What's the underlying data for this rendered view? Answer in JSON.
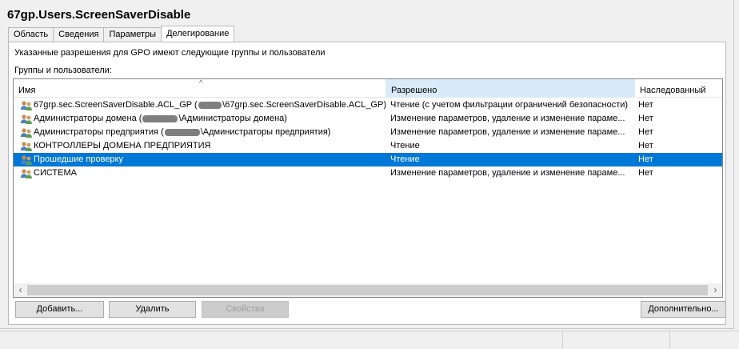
{
  "window": {
    "title": "67gp.Users.ScreenSaverDisable"
  },
  "tabs": [
    {
      "label": "Область",
      "active": false
    },
    {
      "label": "Сведения",
      "active": false
    },
    {
      "label": "Параметры",
      "active": false
    },
    {
      "label": "Делегирование",
      "active": true
    }
  ],
  "delegation": {
    "description": "Указанные разрешения для GPO имеют следующие группы и пользователи",
    "groups_label": "Группы и пользователи:",
    "columns": {
      "name": "Имя",
      "permission": "Разрешено",
      "inherited": "Наследованный"
    },
    "rows": [
      {
        "name_pre": "67grp.sec.ScreenSaverDisable.ACL_GP (",
        "name_post": "\\67grp.sec.ScreenSaverDisable.ACL_GP)",
        "redacted": true,
        "permission": "Чтение (с учетом фильтрации ограничений безопасности)",
        "inherited": "Нет",
        "selected": false,
        "icon": "group-icon"
      },
      {
        "name_pre": "Администраторы домена (",
        "name_post": "\\Администраторы домена)",
        "redacted": true,
        "permission": "Изменение параметров, удаление и изменение параме...",
        "inherited": "Нет",
        "selected": false,
        "icon": "group-icon"
      },
      {
        "name_pre": "Администраторы предприятия (",
        "name_post": "\\Администраторы предприятия)",
        "redacted": true,
        "permission": "Изменение параметров, удаление и изменение параме...",
        "inherited": "Нет",
        "selected": false,
        "icon": "group-icon"
      },
      {
        "name_pre": "КОНТРОЛЛЕРЫ ДОМЕНА ПРЕДПРИЯТИЯ",
        "name_post": "",
        "redacted": false,
        "permission": "Чтение",
        "inherited": "Нет",
        "selected": false,
        "icon": "group-icon"
      },
      {
        "name_pre": "Прошедшие проверку",
        "name_post": "",
        "redacted": false,
        "permission": "Чтение",
        "inherited": "Нет",
        "selected": true,
        "icon": "group-icon"
      },
      {
        "name_pre": "СИСТЕМА",
        "name_post": "",
        "redacted": false,
        "permission": "Изменение параметров, удаление и изменение параме...",
        "inherited": "Нет",
        "selected": false,
        "icon": "group-icon"
      }
    ]
  },
  "scrollbar": {
    "left_icon": "arrow-left-icon",
    "right_icon": "arrow-right-icon",
    "left_glyph": "‹",
    "right_glyph": "›"
  },
  "buttons": {
    "add": "Добавить...",
    "remove": "Удалить",
    "properties": "Свойства",
    "advanced": "Дополнительно..."
  },
  "colors": {
    "selection": "#0078d7",
    "sorted_header": "#d9ebf9"
  }
}
